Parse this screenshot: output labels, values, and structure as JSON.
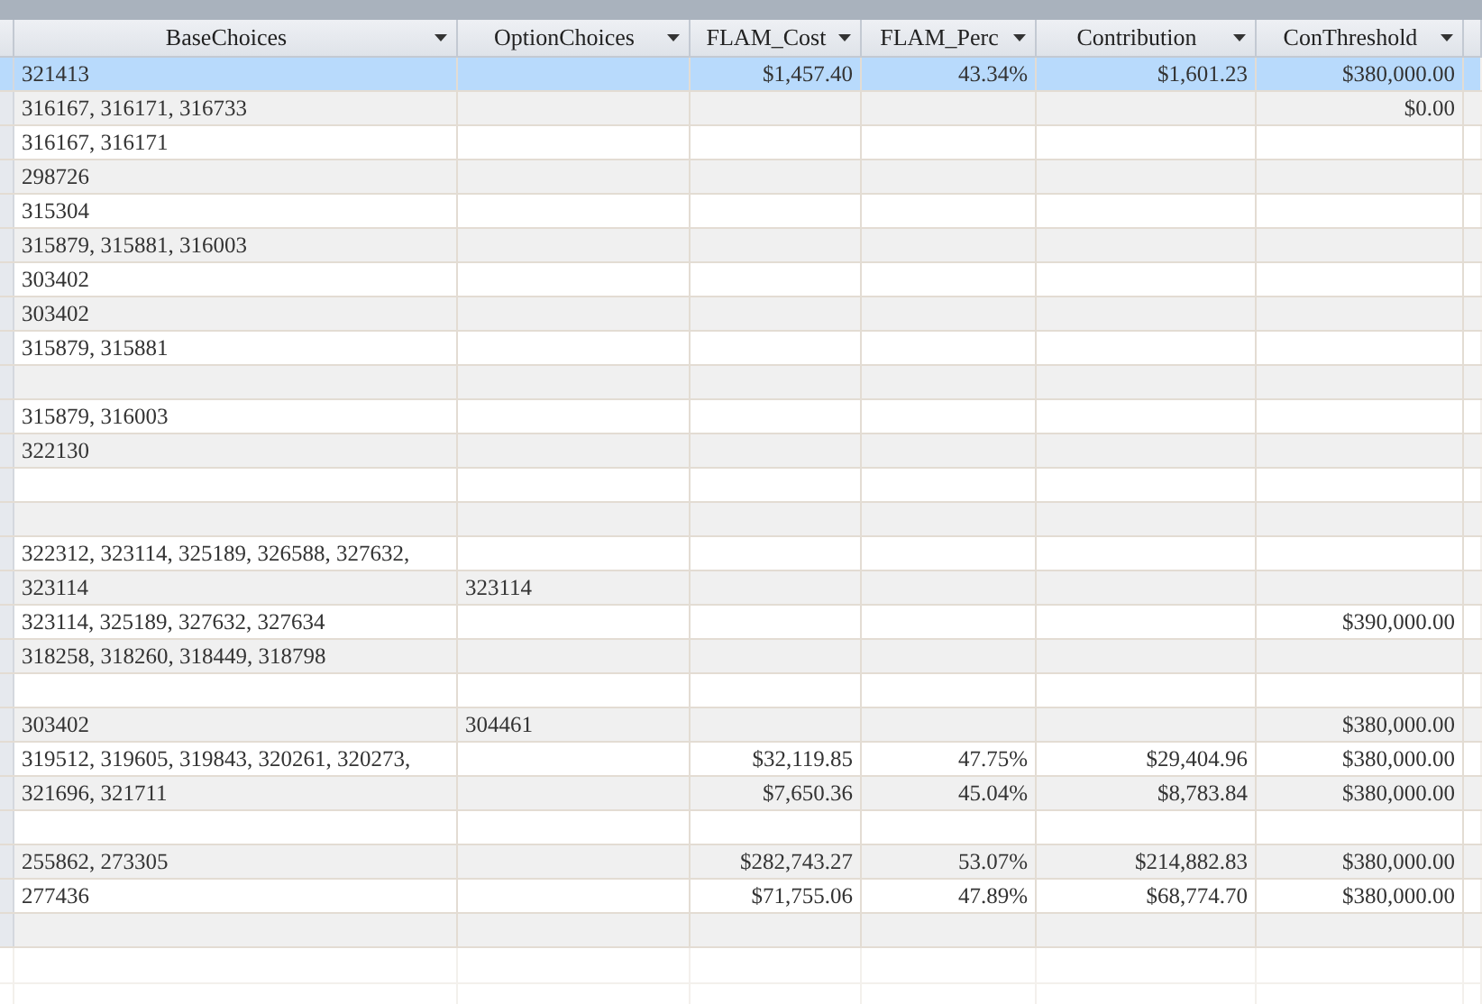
{
  "columns": [
    {
      "label": "BaseChoices",
      "kind": "text"
    },
    {
      "label": "OptionChoices",
      "kind": "text"
    },
    {
      "label": "FLAM_Cost",
      "kind": "number"
    },
    {
      "label": "FLAM_Perc",
      "kind": "number"
    },
    {
      "label": "Contribution",
      "kind": "number"
    },
    {
      "label": "ConThreshold",
      "kind": "number"
    }
  ],
  "rows": [
    {
      "selected": true,
      "cells": [
        "321413",
        null,
        "$1,457.40",
        "43.34%",
        "$1,601.23",
        "$380,000.00"
      ]
    },
    {
      "selected": false,
      "cells": [
        "316167, 316171, 316733",
        null,
        null,
        null,
        null,
        "$0.00"
      ]
    },
    {
      "selected": false,
      "cells": [
        "316167, 316171"
      ]
    },
    {
      "selected": false,
      "cells": [
        "298726"
      ]
    },
    {
      "selected": false,
      "cells": [
        "315304"
      ]
    },
    {
      "selected": false,
      "cells": [
        "315879, 315881, 316003"
      ]
    },
    {
      "selected": false,
      "cells": [
        "303402"
      ]
    },
    {
      "selected": false,
      "cells": [
        "303402"
      ]
    },
    {
      "selected": false,
      "cells": [
        "315879, 315881"
      ]
    },
    {
      "selected": false
    },
    {
      "selected": false,
      "cells": [
        "315879, 316003"
      ]
    },
    {
      "selected": false,
      "cells": [
        "322130"
      ]
    },
    {
      "selected": false
    },
    {
      "selected": false
    },
    {
      "selected": false,
      "cells": [
        "322312, 323114, 325189, 326588, 327632,"
      ]
    },
    {
      "selected": false,
      "cells": [
        "323114",
        "323114"
      ]
    },
    {
      "selected": false,
      "cells": [
        "323114, 325189, 327632, 327634",
        null,
        null,
        null,
        null,
        "$390,000.00"
      ]
    },
    {
      "selected": false,
      "cells": [
        "318258, 318260, 318449, 318798"
      ]
    },
    {
      "selected": false
    },
    {
      "selected": false,
      "cells": [
        "303402",
        "304461",
        null,
        null,
        null,
        "$380,000.00"
      ]
    },
    {
      "selected": false,
      "cells": [
        "319512, 319605, 319843, 320261, 320273,",
        null,
        "$32,119.85",
        "47.75%",
        "$29,404.96",
        "$380,000.00"
      ]
    },
    {
      "selected": false,
      "cells": [
        "321696, 321711",
        null,
        "$7,650.36",
        "45.04%",
        "$8,783.84",
        "$380,000.00"
      ]
    },
    {
      "selected": false
    },
    {
      "selected": false,
      "cells": [
        "255862, 273305",
        null,
        "$282,743.27",
        "53.07%",
        "$214,882.83",
        "$380,000.00"
      ]
    },
    {
      "selected": false,
      "cells": [
        "277436",
        null,
        "$71,755.06",
        "47.89%",
        "$68,774.70",
        "$380,000.00"
      ]
    },
    {
      "selected": false
    }
  ]
}
